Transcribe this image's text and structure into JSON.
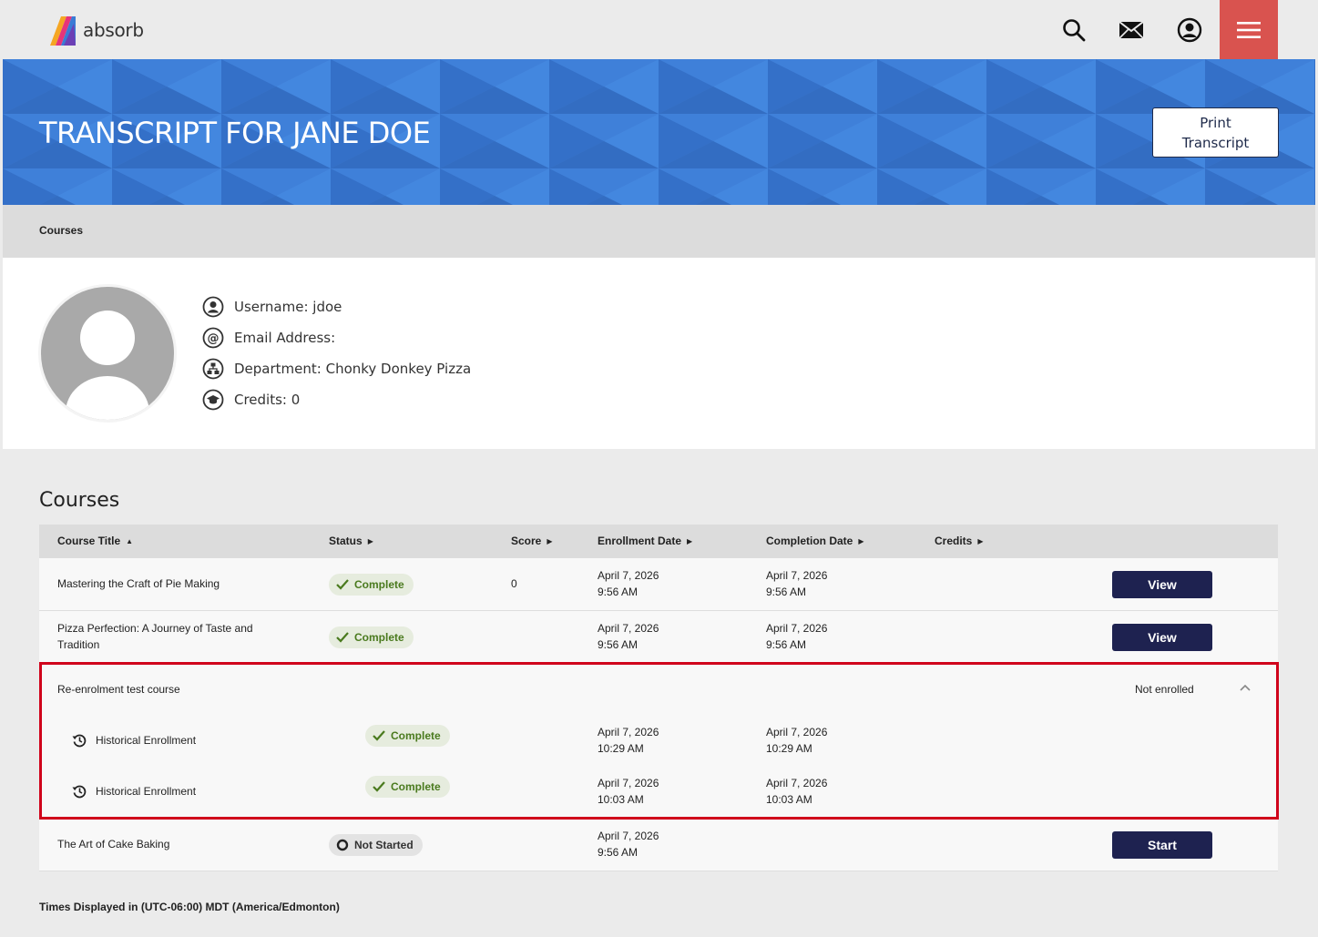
{
  "header": {
    "logo_text": "absorb",
    "icons": [
      "search-icon",
      "mail-icon",
      "user-circle-icon",
      "hamburger-icon"
    ],
    "menu_color": "#d9534f"
  },
  "banner": {
    "title": "TRANSCRIPT FOR JANE DOE",
    "print_button_line1": "Print",
    "print_button_line2": "Transcript",
    "color": "#3a7bd5"
  },
  "breadcrumb": "Courses",
  "profile": {
    "username": "Username: jdoe",
    "email": "Email Address:",
    "department": "Department: Chonky Donkey Pizza",
    "credits": "Credits: 0"
  },
  "courses": {
    "title": "Courses",
    "columns": {
      "title": "Course Title",
      "status": "Status",
      "score": "Score",
      "enrollment": "Enrollment Date",
      "completion": "Completion Date",
      "credits": "Credits"
    },
    "rows": [
      {
        "title": "Mastering the Craft of Pie Making",
        "status": "Complete",
        "score": "0",
        "enroll_date": "April 7, 2026",
        "enroll_time": "9:56 AM",
        "complete_date": "April 7, 2026",
        "complete_time": "9:56 AM",
        "action": "View"
      },
      {
        "title_line1": "Pizza Perfection: A Journey of Taste and",
        "title_line2": "Tradition",
        "status": "Complete",
        "enroll_date": "April 7, 2026",
        "enroll_time": "9:56 AM",
        "complete_date": "April 7, 2026",
        "complete_time": "9:56 AM",
        "action": "View"
      },
      {
        "title": "Re-enrolment test course",
        "enrollment_status": "Not enrolled",
        "history": [
          {
            "label": "Historical Enrollment",
            "status": "Complete",
            "enroll_date": "April 7, 2026",
            "enroll_time": "10:29 AM",
            "complete_date": "April 7, 2026",
            "complete_time": "10:29 AM"
          },
          {
            "label": "Historical Enrollment",
            "status": "Complete",
            "enroll_date": "April 7, 2026",
            "enroll_time": "10:03 AM",
            "complete_date": "April 7, 2026",
            "complete_time": "10:03 AM"
          }
        ]
      },
      {
        "title": "The Art of Cake Baking",
        "status": "Not Started",
        "enroll_date": "April 7, 2026",
        "enroll_time": "9:56 AM",
        "action": "Start"
      }
    ],
    "highlight_color": "#d0021b"
  },
  "footnote": "Times Displayed in (UTC-06:00) MDT (America/Edmonton)"
}
